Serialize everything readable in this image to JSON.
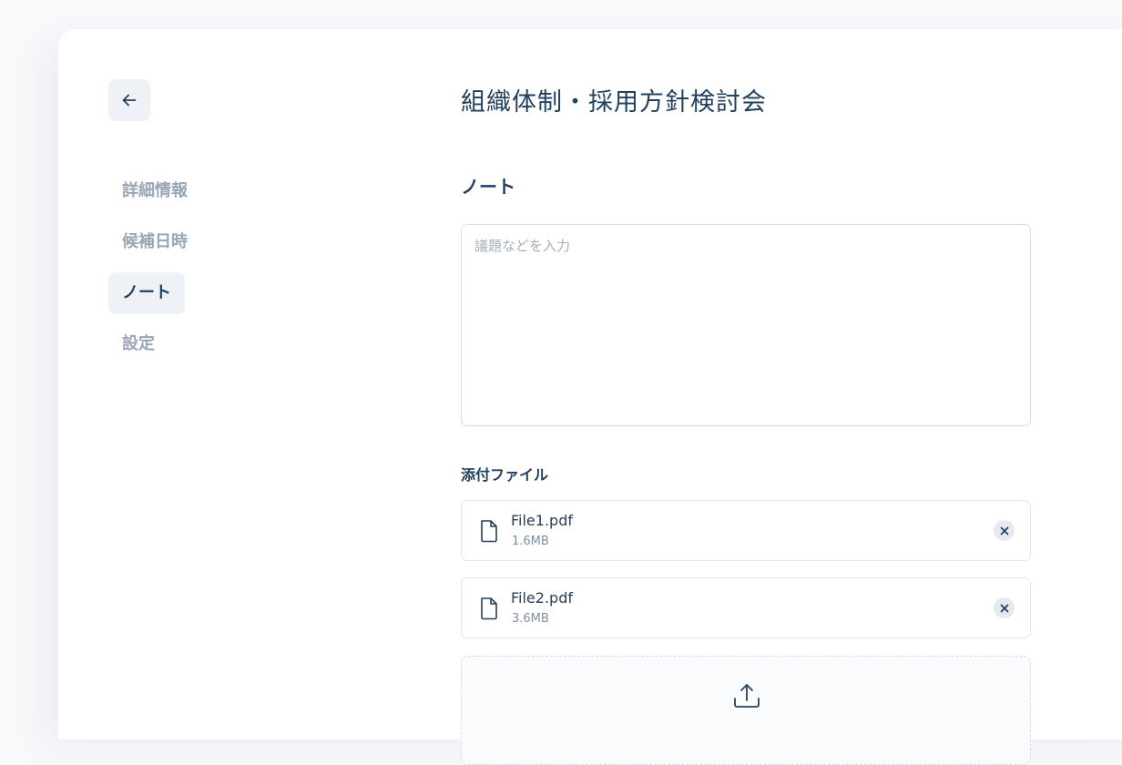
{
  "page": {
    "title": "組織体制・採用方針検討会"
  },
  "nav": {
    "items": [
      {
        "label": "詳細情報",
        "active": false
      },
      {
        "label": "候補日時",
        "active": false
      },
      {
        "label": "ノート",
        "active": true
      },
      {
        "label": "設定",
        "active": false
      }
    ]
  },
  "note": {
    "section_title": "ノート",
    "placeholder": "議題などを入力",
    "value": ""
  },
  "attachments": {
    "title": "添付ファイル",
    "files": [
      {
        "name": "File1.pdf",
        "size": "1.6MB"
      },
      {
        "name": "File2.pdf",
        "size": "3.6MB"
      }
    ]
  },
  "icons": {
    "back": "arrow-left-icon",
    "file": "file-icon",
    "remove": "close-icon",
    "upload": "upload-icon"
  },
  "colors": {
    "primary_text": "#22405f",
    "muted_text": "#98a6b7",
    "active_bg": "#eef1f5"
  }
}
